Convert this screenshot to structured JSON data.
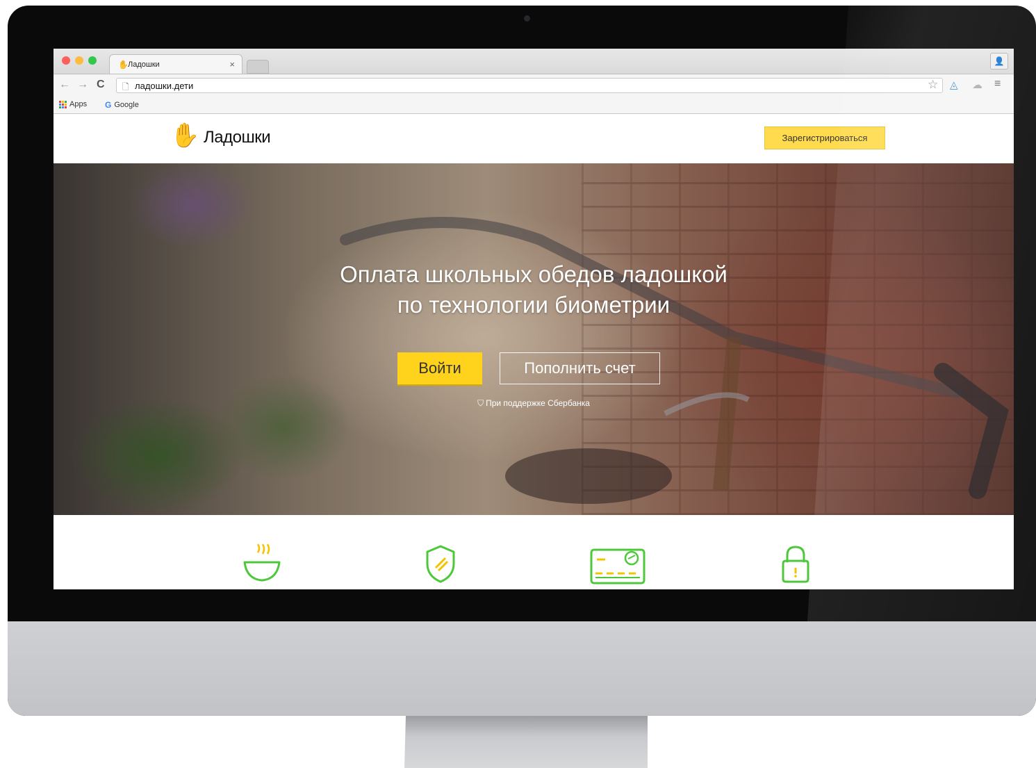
{
  "browser": {
    "tab_title": "Ладошки",
    "tab_close": "×",
    "url": "ладошки.дети",
    "bookmarks": [
      {
        "label": "Apps"
      },
      {
        "label": "Google"
      }
    ],
    "traffic_light_colors": [
      "#fc605c",
      "#fdbc40",
      "#34c84a"
    ]
  },
  "site": {
    "logo_text": "Ладошки",
    "register_label": "Зарегистрироваться",
    "hero": {
      "title_line1": "Оплата школьных обедов ладошкой",
      "title_line2": "по технологии биометрии",
      "login_label": "Войти",
      "topup_label": "Пополнить счет",
      "sponsor_text": "При поддержке Сбербанка"
    },
    "features": [
      {
        "icon": "soup-bowl-icon"
      },
      {
        "icon": "shield-icon"
      },
      {
        "icon": "card-icon"
      },
      {
        "icon": "lock-icon"
      }
    ],
    "colors": {
      "accent_yellow": "#ffd21c",
      "icon_green": "#4cc83a"
    }
  }
}
